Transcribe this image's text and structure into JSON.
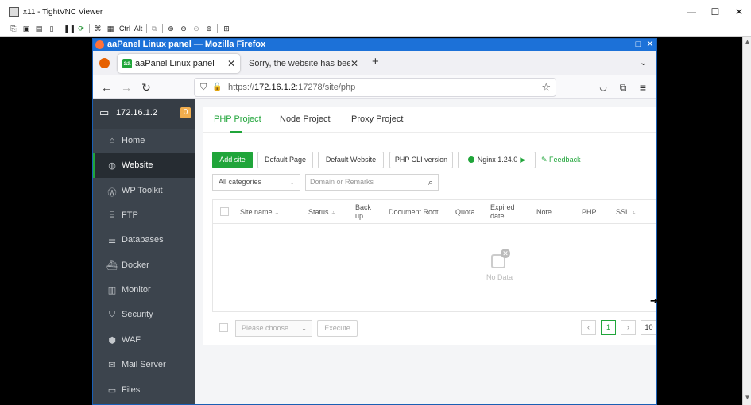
{
  "vnc": {
    "title": "x11 - TightVNC Viewer",
    "toolbar": [
      "Ctrl",
      "Alt"
    ]
  },
  "firefox": {
    "window_title": "aaPanel Linux panel — Mozilla Firefox",
    "tabs": [
      {
        "label": "aaPanel Linux panel",
        "favicon": "aa"
      },
      {
        "label": "Sorry, the website has been"
      }
    ],
    "url_prefix": "https://",
    "url_host": "172.16.1.2",
    "url_path": ":17278/site/php"
  },
  "panel": {
    "host": "172.16.1.2",
    "badge": "0",
    "nav": [
      {
        "label": "Home",
        "icon": "home-icon"
      },
      {
        "label": "Website",
        "icon": "globe-icon"
      },
      {
        "label": "WP Toolkit",
        "icon": "wordpress-icon"
      },
      {
        "label": "FTP",
        "icon": "ftp-icon"
      },
      {
        "label": "Databases",
        "icon": "database-icon"
      },
      {
        "label": "Docker",
        "icon": "docker-icon"
      },
      {
        "label": "Monitor",
        "icon": "monitor-icon"
      },
      {
        "label": "Security",
        "icon": "shield-icon"
      },
      {
        "label": "WAF",
        "icon": "waf-icon"
      },
      {
        "label": "Mail Server",
        "icon": "mail-icon"
      },
      {
        "label": "Files",
        "icon": "folder-icon"
      }
    ],
    "subtabs": [
      "PHP Project",
      "Node Project",
      "Proxy Project"
    ],
    "buttons": {
      "add_site": "Add site",
      "default_page": "Default Page",
      "default_website": "Default Website",
      "php_cli": "PHP CLI version",
      "nginx": "Nginx 1.24.0",
      "feedback": "Feedback"
    },
    "category": "All categories",
    "search_placeholder": "Domain or Remarks",
    "columns": [
      "Site name",
      "Status",
      "Back up",
      "Document Root",
      "Quota",
      "Expired date",
      "Note",
      "PHP",
      "SSL"
    ],
    "no_data": "No Data",
    "batch_placeholder": "Please choose",
    "execute": "Execute",
    "page": "1",
    "page_size": "10"
  },
  "colors": {
    "accent": "#20a53a",
    "sidebar": "#3c444d",
    "firefox_title": "#1c71d8"
  }
}
